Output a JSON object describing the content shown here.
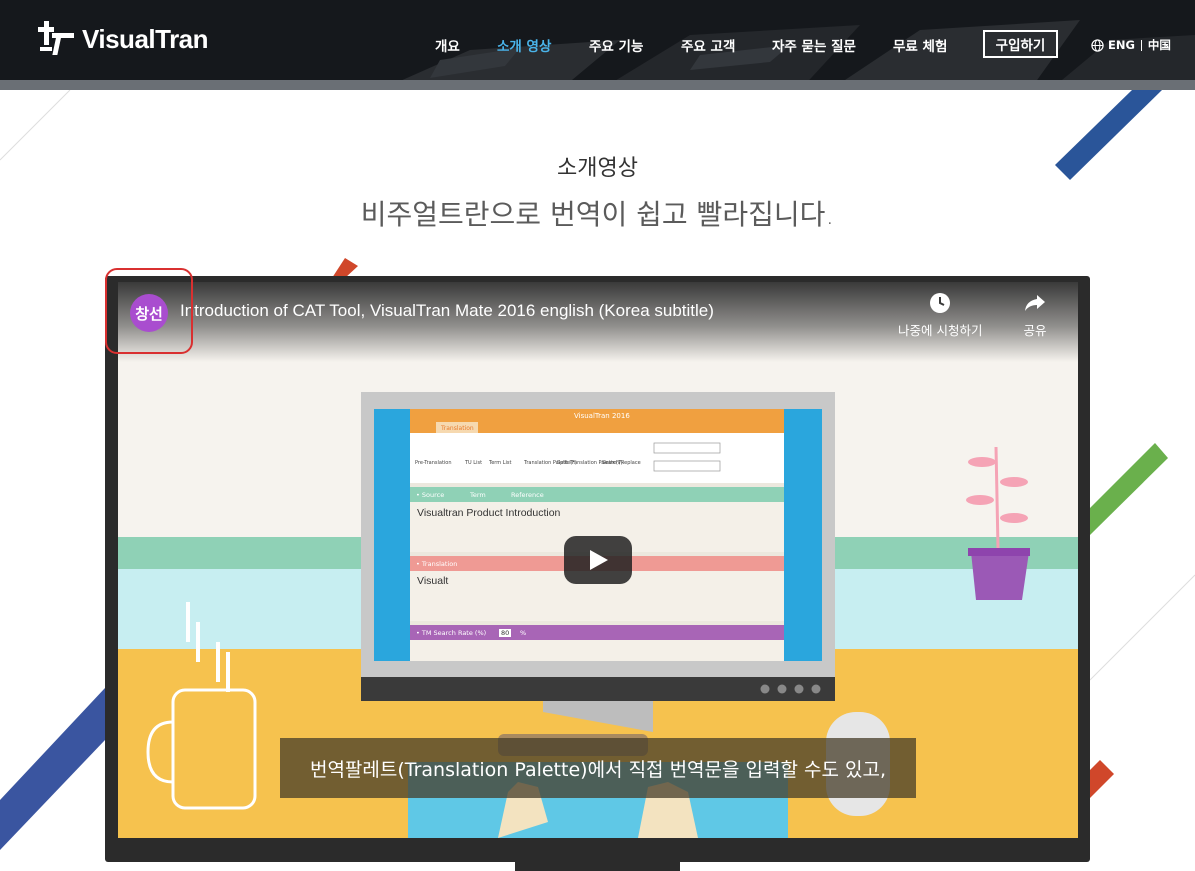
{
  "header": {
    "logo_text": "VisualTran",
    "nav": [
      {
        "label": "개요",
        "active": false
      },
      {
        "label": "소개 영상",
        "active": true
      },
      {
        "label": "주요 기능",
        "active": false
      },
      {
        "label": "주요 고객",
        "active": false
      },
      {
        "label": "자주 묻는 질문",
        "active": false
      },
      {
        "label": "무료 체험",
        "active": false
      }
    ],
    "buy_label": "구입하기",
    "lang_eng": "ENG",
    "lang_cn": "中国"
  },
  "section": {
    "title": "소개영상",
    "subtitle": "비주얼트란으로 번역이 쉽고 빨라집니다."
  },
  "video": {
    "channel_avatar": "창선",
    "title": "Introduction of CAT Tool, VisualTran Mate 2016 english (Korea subtitle)",
    "watch_later": "나중에 시청하기",
    "share": "공유",
    "subtitle": "번역팔레트(Translation Palette)에서 직접 번역문을 입력할 수도 있고,",
    "app": {
      "window_title": "VisualTran 2016",
      "tab": "Translation",
      "tools": [
        "Pre-Translation",
        "TU List",
        "Term List",
        "Translation Palette(F)",
        "Split Translation Palette(T)",
        "Search/Replace"
      ],
      "source_label": "• Source",
      "term_label": "Term",
      "reference_label": "Reference",
      "source_text": "Visualtran Product Introduction",
      "translation_label": "• Translation",
      "translation_text": "Visualt",
      "tm_label": "• TM Search Rate (%)",
      "tm_value": "80",
      "tm_unit": "%"
    }
  },
  "colors": {
    "header_bg": "#15181c",
    "nav_active": "#4ab4ea",
    "stripe_blue": "#2a5599",
    "stripe_green": "#6ab04c",
    "stripe_red": "#d0472a",
    "avatar": "#a94dcf",
    "highlight": "#d93030"
  }
}
